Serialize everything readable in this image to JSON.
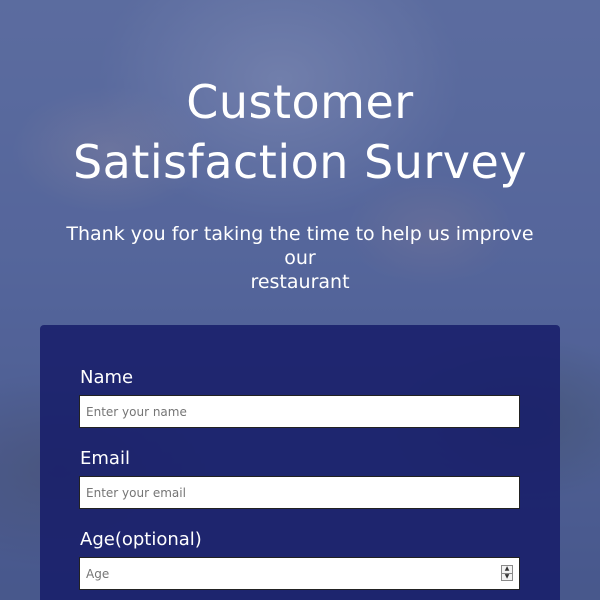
{
  "header": {
    "title_line1": "Customer",
    "title_line2": "Satisfaction Survey",
    "subtitle_line1": "Thank you for taking the time to help us improve our",
    "subtitle_line2": "restaurant"
  },
  "form": {
    "fields": [
      {
        "label": "Name",
        "placeholder": "Enter your name",
        "value": ""
      },
      {
        "label": "Email",
        "placeholder": "Enter your email",
        "value": ""
      },
      {
        "label": "Age(optional)",
        "placeholder": "Age",
        "value": ""
      }
    ]
  },
  "colors": {
    "overlay": "#34488c",
    "card": "#161c69",
    "text": "#ffffff"
  },
  "icons": {
    "age_spinner_up": "triangle-up-icon",
    "age_spinner_down": "triangle-down-icon"
  }
}
